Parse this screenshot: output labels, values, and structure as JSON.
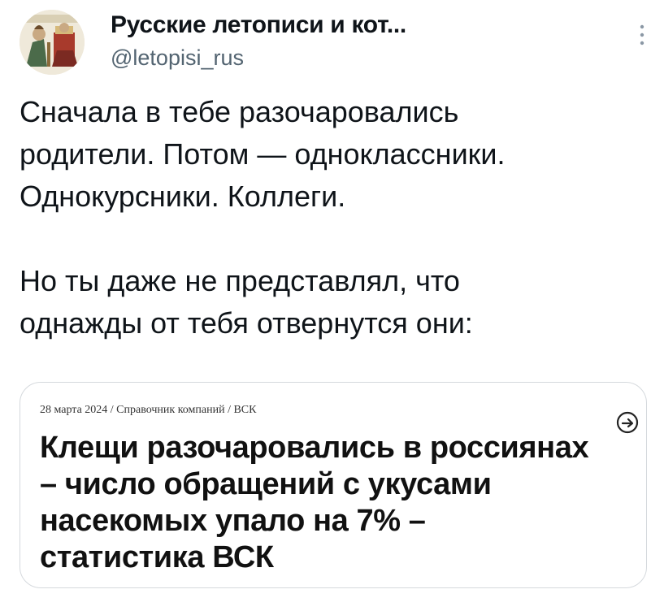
{
  "author": {
    "name": "Русские летописи и кот...",
    "handle": "@letopisi_rus"
  },
  "icons": {
    "avatar": "medieval-miniature-avatar",
    "more": "vertical-ellipsis-icon",
    "share": "arrow-circle-icon"
  },
  "post": {
    "paragraph_1": "Сначала в тебе разочаровались\nродители. Потом — одноклассники.\nОднокурсники. Коллеги.",
    "paragraph_2": "Но ты даже не представлял, что\nоднажды от тебя отвернутся они:"
  },
  "article": {
    "meta": "28 марта 2024 / Справочник компаний / ВСК",
    "title": "Клещи разочаровались в россиянах\n– число обращений с укусами\nнасекомых упало на 7% –\nстатистика ВСК"
  },
  "colors": {
    "text": "#0f1419",
    "secondary_text": "#536471",
    "card_border": "#d5d9dd"
  }
}
